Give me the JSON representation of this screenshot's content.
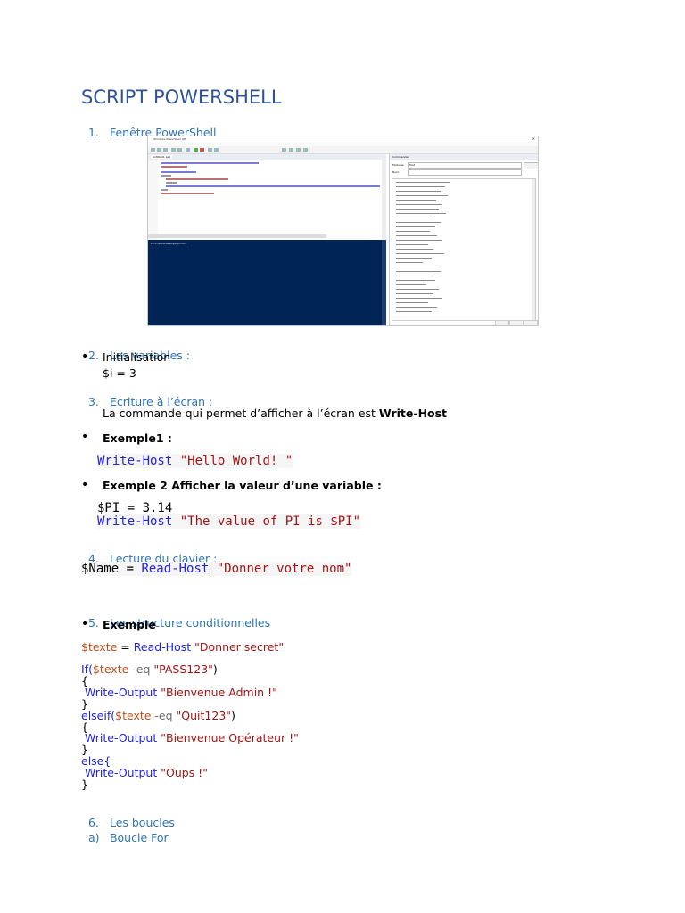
{
  "title": "SCRIPT POWERSHELL",
  "sections": {
    "s1": {
      "num": "1.",
      "label": "Fenêtre PowerShell"
    },
    "s2": {
      "num": "2.",
      "label": "Les variables :"
    },
    "s3": {
      "num": "3.",
      "label": "Ecriture à l’écran :"
    },
    "s4": {
      "num": "4.",
      "label": "Lecture du clavier :"
    },
    "s5": {
      "num": "5.",
      "label": "Les structure conditionnelles"
    },
    "s6": {
      "num": "6.",
      "label": "Les boucles"
    },
    "s6a": {
      "num": "a)",
      "label": "Boucle For"
    }
  },
  "bullet_glyph": "•",
  "variables": {
    "bullet": "Initialisation",
    "code": "$i = 3"
  },
  "ecriture": {
    "intro_prefix": "La commande qui permet d’afficher à l’écran est ",
    "intro_bold": "Write-Host",
    "ex1_label": "Exemple1 :",
    "ex1_cmd": "Write-Host",
    "ex1_str": "\"Hello World! \"",
    "ex2_label": "Exemple 2 Afficher la valeur d’une variable :",
    "ex2_line1": "$PI = 3.14",
    "ex2_cmd": "Write-Host",
    "ex2_str": "\"The value of PI is $PI\""
  },
  "lecture": {
    "var": "$Name",
    "eq": " = ",
    "cmd": "Read-Host",
    "str": "\"Donner votre nom\""
  },
  "conditions": {
    "bullet": "Exemple",
    "l1_var": "$texte",
    "l1_eq": " = ",
    "l1_cmd": "Read-Host",
    "l1_str": "\"Donner secret\"",
    "l2_if": "If(",
    "l2_var": "$texte",
    "l2_op": " -eq ",
    "l2_str": "\"PASS123\"",
    "l2_close": ")",
    "brace_open": "{",
    "brace_close": "}",
    "l4_cmd": " Write-Output",
    "l4_str": "\"Bienvenue Admin !\"",
    "l6_elseif": "elseif(",
    "l6_var": "$texte",
    "l6_op": " -eq ",
    "l6_str": "\"Quit123\"",
    "l6_close": ")",
    "l8_cmd": " Write-Output",
    "l8_str": "\"Bienvenue Opérateur !\"",
    "l10_else": "else{",
    "l11_cmd": " Write-Output",
    "l11_str": "\"Oups !\""
  },
  "ise_screenshot": {
    "window_title": "Windows PowerShell ISE",
    "tab_label": "Untitled1.ps1",
    "console_prompt": "PS C:\\Windows\\system32>",
    "commands_title": "Commandes",
    "modules_label": "Modules:",
    "modules_value": "Tout",
    "name_label": "Nom:"
  },
  "colors": {
    "title": "#2f5496",
    "heading": "#2e74b5",
    "keyword": "#2323e0",
    "string": "#a31515",
    "variable": "#c0501a",
    "console_bg": "#012456"
  }
}
